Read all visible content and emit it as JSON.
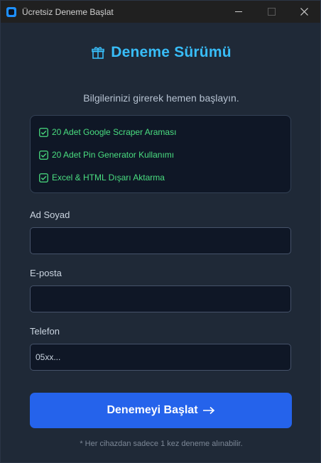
{
  "window": {
    "title": "Ücretsiz Deneme Başlat",
    "controls": [
      "minimize-icon",
      "maximize-icon",
      "close-icon"
    ]
  },
  "header": {
    "title": "Deneme Sürümü",
    "icon": "gift-icon",
    "subtitle": "Bilgilerinizi girerek hemen başlayın."
  },
  "features": [
    {
      "label": "20 Adet Google Scraper Araması",
      "icon": "checkbox-checked-icon"
    },
    {
      "label": "20 Adet Pin Generator Kullanımı",
      "icon": "checkbox-checked-icon"
    },
    {
      "label": "Excel & HTML Dışarı Aktarma",
      "icon": "checkbox-checked-icon"
    }
  ],
  "form": {
    "name": {
      "label": "Ad Soyad",
      "value": "",
      "placeholder": ""
    },
    "email": {
      "label": "E-posta",
      "value": "",
      "placeholder": ""
    },
    "phone": {
      "label": "Telefon",
      "value": "",
      "placeholder": "05xx..."
    }
  },
  "submit": {
    "label": "Denemeyi Başlat",
    "icon": "arrow-right-icon"
  },
  "footnote": "* Her cihazdan sadece 1 kez deneme alınabilir.",
  "colors": {
    "accent": "#38bdf8",
    "button": "#2563eb",
    "success": "#4ade80",
    "background": "#1f2937",
    "panel": "#0f1726"
  }
}
